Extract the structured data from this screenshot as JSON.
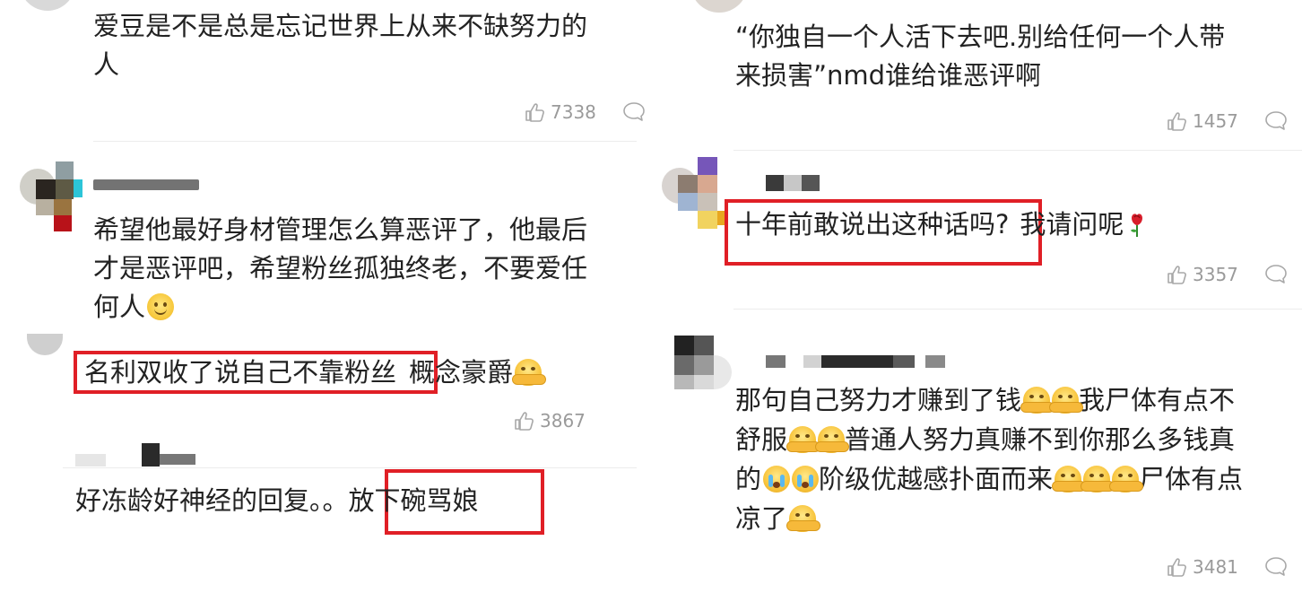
{
  "left": {
    "comment_1": {
      "lines": [
        "爱豆是不是总是忘记世界上从来不缺努力的",
        "人"
      ],
      "likes": "7338"
    },
    "comment_2": {
      "lines": [
        "希望他最好身材管理怎么算恶评了，他最后",
        "才是恶评吧，希望粉丝孤独终老，不要爱任",
        "何人"
      ],
      "emoji": "smile-emoji"
    },
    "comment_3": {
      "highlighted": "名利双收了说自己不靠粉丝",
      "rest": "概念豪爵",
      "emoji": "hug-emoji",
      "likes": "3867"
    },
    "comment_4": {
      "plain": "好冻龄好神经的回复。。",
      "highlighted": "放下碗骂娘"
    }
  },
  "right": {
    "comment_1": {
      "lines": [
        "“你独自一个人活下去吧.别给任何一个人带",
        "来损害”nmd谁给谁恶评啊"
      ],
      "likes": "1457"
    },
    "comment_2": {
      "highlighted": "十年前敢说出这种话吗?",
      "rest": "我请问呢",
      "emoji": "rose-emoji",
      "likes": "3357"
    },
    "comment_3": {
      "line_1": "那句自己努力才赚到了钱",
      "line_1_after": "我尸体有点不",
      "line_2_a": "舒服",
      "line_2_b": "普通人努力真赚不到你那么多钱真",
      "line_3_a": "的",
      "line_3_b": "阶级优越感扑面而来",
      "line_3_c": "尸体有点",
      "line_4": "凉了",
      "likes": "3481"
    }
  },
  "colors": {
    "highlight_border": "#e01f26",
    "meta_text": "#9a9a9a",
    "body_text": "#222222"
  },
  "icons": {
    "like": "thumbs-up-icon",
    "reply": "comment-bubble-icon"
  }
}
